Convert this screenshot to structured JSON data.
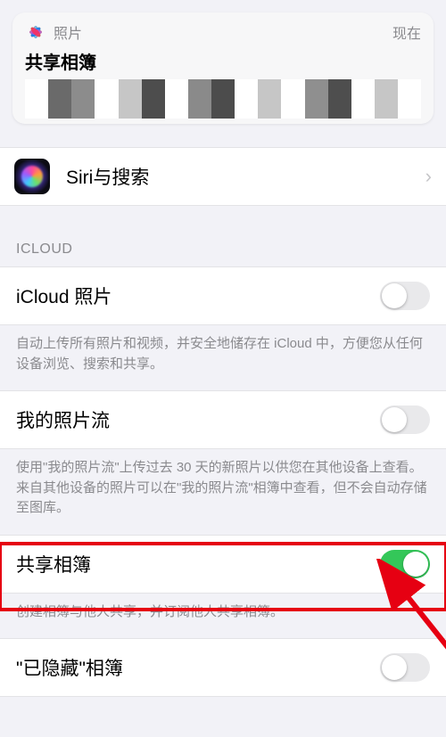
{
  "notification": {
    "app_name": "照片",
    "time": "现在",
    "title": "共享相簿"
  },
  "siri": {
    "label": "Siri与搜索"
  },
  "icloud_section": {
    "header": "ICLOUD",
    "icloud_photos": {
      "label": "iCloud 照片",
      "enabled": false,
      "footer": "自动上传所有照片和视频，并安全地储存在 iCloud 中，方便您从任何设备浏览、搜索和共享。"
    },
    "my_photo_stream": {
      "label": "我的照片流",
      "enabled": false,
      "footer": "使用\"我的照片流\"上传过去 30 天的新照片以供您在其他设备上查看。来自其他设备的照片可以在\"我的照片流\"相簿中查看，但不会自动存储至图库。"
    },
    "shared_albums": {
      "label": "共享相簿",
      "enabled": true,
      "footer": "创建相簿与他人共享，并订阅他人共享相簿。"
    },
    "hidden_album": {
      "label": "\"已隐藏\"相簿",
      "enabled": false
    }
  },
  "pixel_colors": [
    "#fff",
    "#6a6a6a",
    "#8c8c8c",
    "#fff",
    "#c6c6c6",
    "#4d4d4d",
    "#fff",
    "#8a8a8a",
    "#4c4c4c",
    "#fff",
    "#c6c6c6",
    "#fff",
    "#8f8f8f",
    "#4e4e4e",
    "#fff",
    "#c6c6c6",
    "#fff"
  ]
}
